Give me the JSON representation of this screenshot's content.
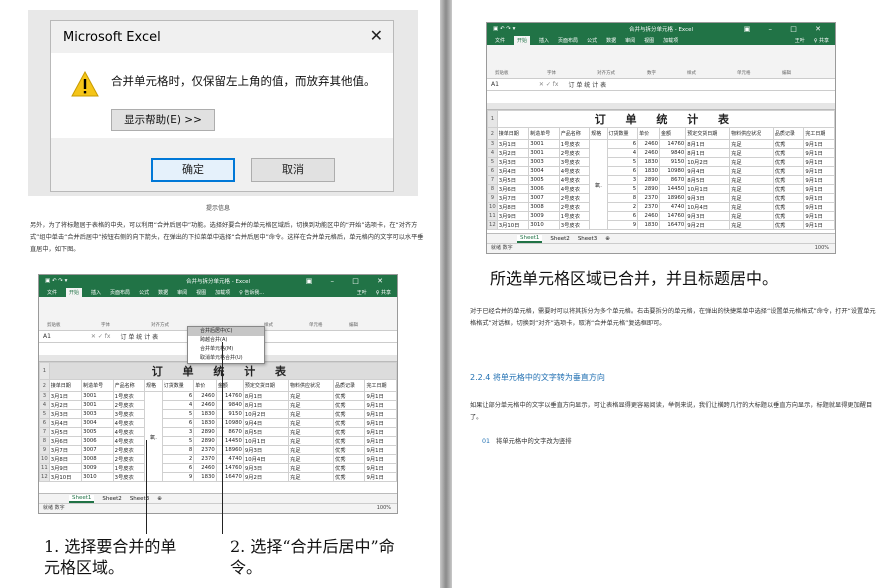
{
  "dialog": {
    "title": "Microsoft Excel",
    "close": "✕",
    "message": "合并单元格时，仅保留左上角的值，而放弃其他值。",
    "help_button": "显示帮助(E) >>",
    "ok_button": "确定",
    "cancel_button": "取消",
    "caption": "提示信息"
  },
  "left_paragraph": "另外，为了将标题居于表格的中央，可以利用“合并后居中”功能。选择好要合并的单元格区域后，切换到功能区中的“开始”选项卡，在“对齐方式”组中单击“合并后居中”按钮右侧的向下箭头，在弹出的下拉菜单中选择“合并后居中”命令。这样在合并单元格后，单元格内的文字可以水平垂直居中，如下图。",
  "excel": {
    "title": "合并与拆分单元格 - Excel",
    "tabs": [
      "文件",
      "开始",
      "插入",
      "页面布局",
      "公式",
      "数据",
      "审阅",
      "视图",
      "加载项",
      "♀ 告诉我..."
    ],
    "user": "王叶",
    "share": "♀ 共享",
    "groups": [
      "剪贴板",
      "字体",
      "对齐方式",
      "数字",
      "样式",
      "单元格",
      "编辑"
    ],
    "cell_ref": "A1",
    "formula_content": "订 单 统 计 表",
    "table_title": "订 单 统 计 表",
    "headers": [
      "接单日期",
      "制造单号",
      "产品名称",
      "规格",
      "订货数量",
      "单价",
      "金额",
      "预定交货日期",
      "物料供应状况",
      "品质记录",
      "完工日期"
    ],
    "rows": [
      [
        "3月1日",
        "3001",
        "1号皮衣",
        "",
        "6",
        "2460",
        "14760",
        "8月1日",
        "充足",
        "优秀",
        "9月1日"
      ],
      [
        "3月2日",
        "3001",
        "2号皮衣",
        "",
        "4",
        "2460",
        "9840",
        "8月1日",
        "充足",
        "优秀",
        "9月1日"
      ],
      [
        "3月3日",
        "3003",
        "3号皮衣",
        "",
        "5",
        "1830",
        "9150",
        "10月2日",
        "充足",
        "优秀",
        "9月1日"
      ],
      [
        "3月4日",
        "3004",
        "4号皮衣",
        "",
        "6",
        "1830",
        "10980",
        "9月4日",
        "充足",
        "优秀",
        "9月1日"
      ],
      [
        "3月5日",
        "3005",
        "4号皮衣",
        "",
        "3",
        "2890",
        "8670",
        "8月5日",
        "充足",
        "优秀",
        "9月1日"
      ],
      [
        "3月6日",
        "3006",
        "4号皮衣",
        "",
        "5",
        "2890",
        "14450",
        "10月1日",
        "充足",
        "优秀",
        "9月1日"
      ],
      [
        "3月7日",
        "3007",
        "2号皮衣",
        "",
        "8",
        "2370",
        "18960",
        "9月3日",
        "充足",
        "优秀",
        "9月1日"
      ],
      [
        "3月8日",
        "3008",
        "2号皮衣",
        "",
        "2",
        "2370",
        "4740",
        "10月4日",
        "充足",
        "优秀",
        "9月1日"
      ],
      [
        "3月9日",
        "3009",
        "1号皮衣",
        "",
        "6",
        "2460",
        "14760",
        "9月3日",
        "充足",
        "优秀",
        "9月1日"
      ],
      [
        "3月10日",
        "3010",
        "3号皮衣",
        "",
        "9",
        "1830",
        "16470",
        "9月2日",
        "充足",
        "优秀",
        "9月1日"
      ]
    ],
    "merged_spec": "氧.",
    "sheets": [
      "Sheet1",
      "Sheet2",
      "Sheet3"
    ],
    "status": "就绪  数字",
    "zoom": "100%",
    "menu_items": [
      "合并后居中(C)",
      "跨越合并(A)",
      "合并单元格(M)",
      "取消单元格合并(U)"
    ]
  },
  "callout_1": "1. 选择要合并的单元格区域。",
  "callout_2": "2. 选择“合并后居中”命令。",
  "right_caption": "所选单元格区域已合并，并且标题居中。",
  "right_paragraph": "对于已经合并的单元格，需要时可以将其拆分为多个单元格。右击要拆分的单元格，在弹出的快捷菜单中选择“设置单元格格式”命令，打开“设置单元格格式”对话框，切换到“对齐”选项卡，取消“合并单元格”复选框即可。",
  "section_heading": "2.2.4  将单元格中的文字转为垂直方向",
  "section_paragraph": "如果让部分单元格中的文字以垂直方向显示，可让表格显得更容易阅读，举例来说，我们让横跨几行的大标题以垂直方向显示，标题就显得更加醒目了。",
  "step_number": "01",
  "step_text": "将单元格中的文字改为竖排"
}
